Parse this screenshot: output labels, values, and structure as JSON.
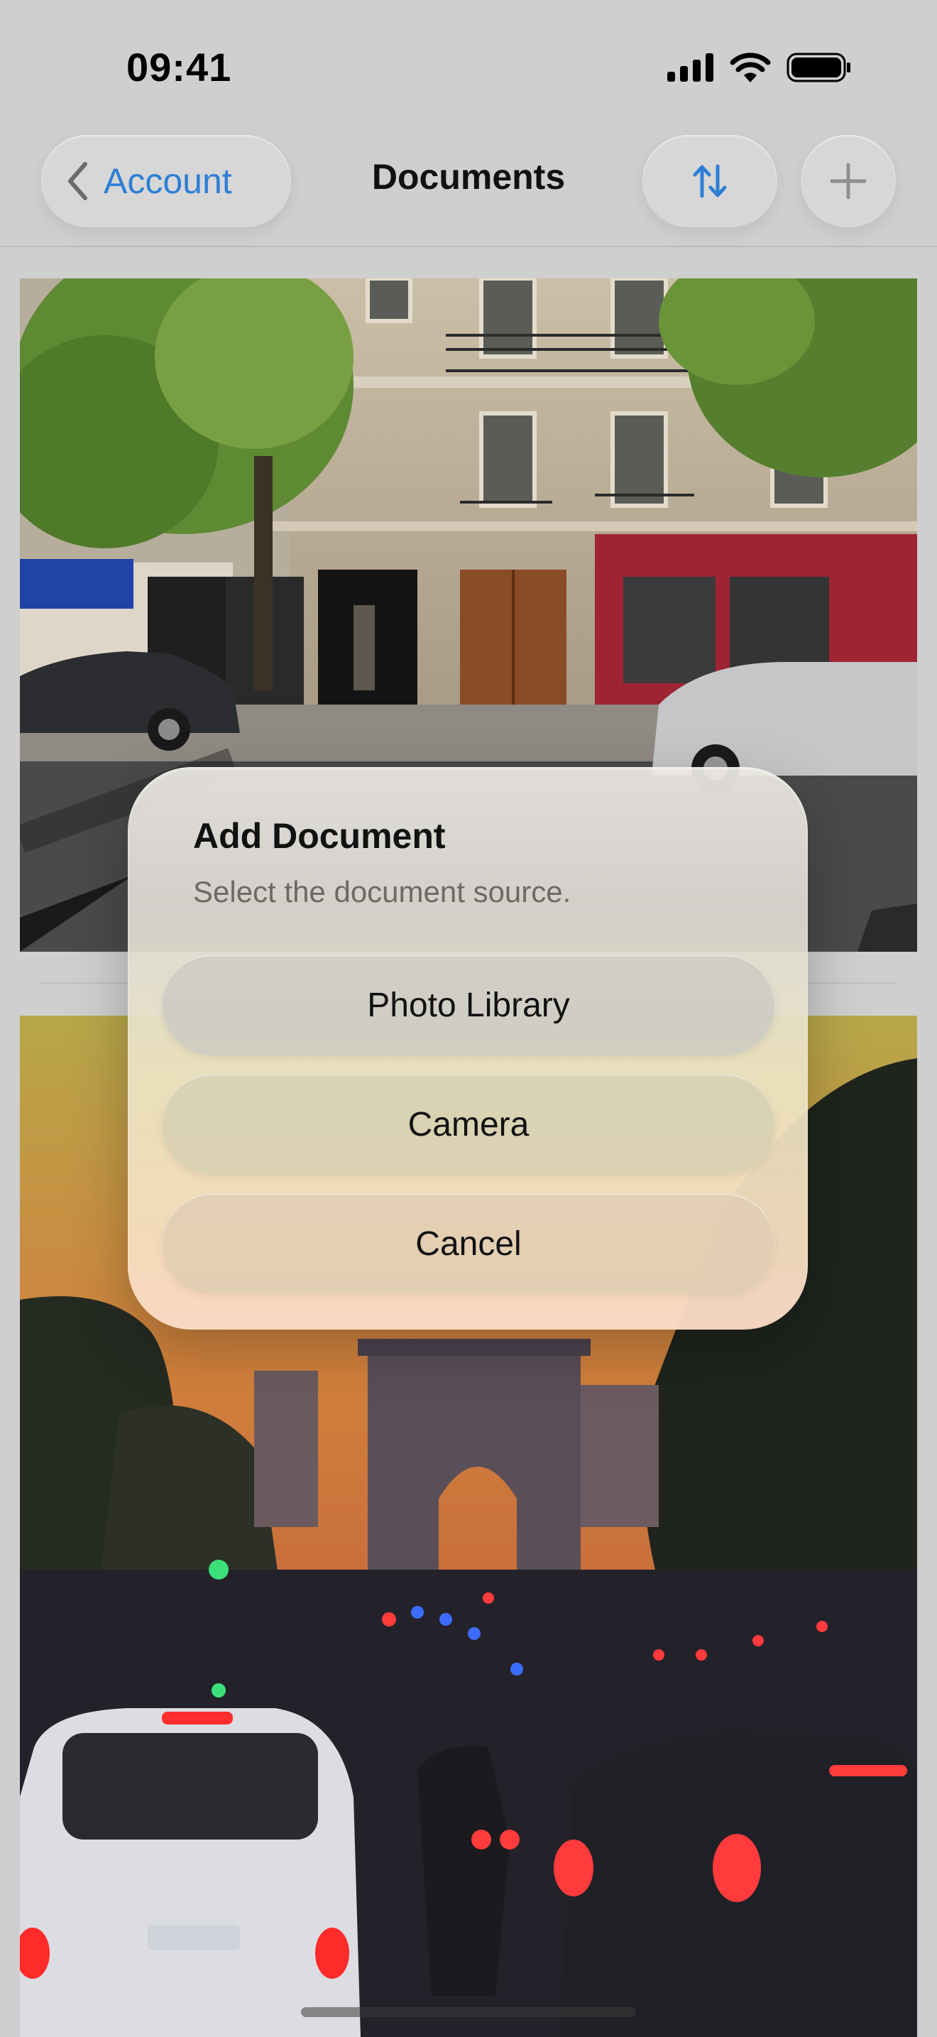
{
  "status_bar": {
    "time": "09:41",
    "icons": [
      "cellular-signal-icon",
      "wifi-icon",
      "battery-icon"
    ]
  },
  "nav": {
    "back_label": "Account",
    "title": "Documents",
    "sort_icon": "sort-arrows-icon",
    "add_icon": "plus-icon"
  },
  "documents": [
    {
      "kind": "photo",
      "subject": "street-facade"
    },
    {
      "kind": "photo",
      "subject": "sunset-traffic"
    }
  ],
  "alert": {
    "title": "Add Document",
    "message": "Select the document source.",
    "buttons": [
      "Photo Library",
      "Camera",
      "Cancel"
    ]
  },
  "colors": {
    "accent": "#2d7fd6",
    "background": "#cfcfcf"
  }
}
